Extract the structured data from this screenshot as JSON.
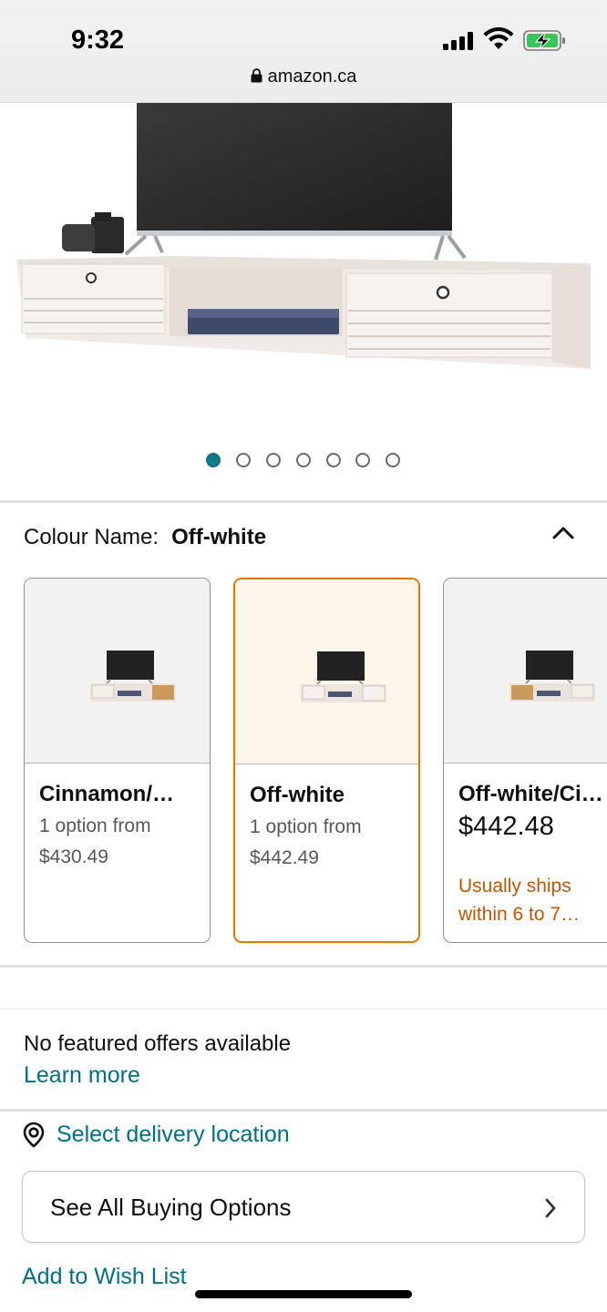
{
  "status_bar": {
    "time": "9:32",
    "battery_state": "charging"
  },
  "address_bar": {
    "url": "amazon.ca",
    "icon": "lock-icon"
  },
  "gallery": {
    "image_count": 7,
    "active_index": 0
  },
  "colour": {
    "label": "Colour Name:",
    "selected": "Off-white",
    "collapse_icon": "chevron-up-icon",
    "options": [
      {
        "name": "Cinnamon/…",
        "sub": "1 option from",
        "price": "$430.49"
      },
      {
        "name": "Off-white",
        "sub": "1 option from",
        "price": "$442.49"
      },
      {
        "name": "Off-white/Ci…",
        "price": "$442.48",
        "ship_line1": "Usually ships",
        "ship_line2": "within 6 to 7…"
      }
    ]
  },
  "offers": {
    "text": "No featured offers available",
    "learn_more": "Learn more"
  },
  "delivery": {
    "text": "Select delivery location",
    "icon": "location-pin-icon"
  },
  "buying_options": {
    "label": "See All Buying Options",
    "icon": "chevron-right-icon"
  },
  "wish_list": {
    "label": "Add to Wish List"
  },
  "colors": {
    "link": "#007185",
    "selected_border": "#e77600",
    "ship_text": "#c45500",
    "dot_active": "#0e7c8a"
  }
}
